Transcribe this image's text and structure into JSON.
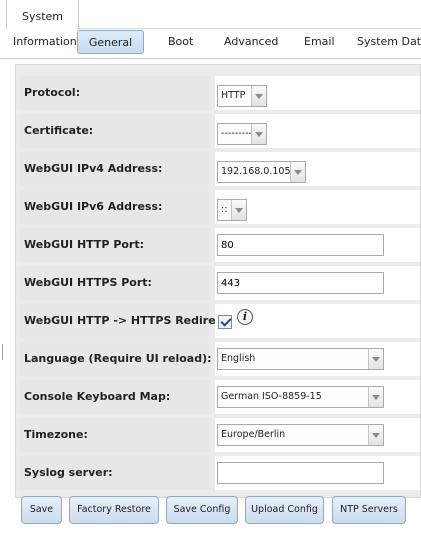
{
  "top_tab": "System",
  "subtabs": [
    "Information",
    "General",
    "Boot",
    "Advanced",
    "Email",
    "System Datas"
  ],
  "fields": {
    "protocol": {
      "label": "Protocol:",
      "value": "HTTP"
    },
    "certificate": {
      "label": "Certificate:",
      "value": "---------"
    },
    "ipv4": {
      "label": "WebGUI IPv4 Address:",
      "value": "192.168.0.105"
    },
    "ipv6": {
      "label": "WebGUI IPv6 Address:",
      "value": "::"
    },
    "http_port": {
      "label": "WebGUI HTTP Port:",
      "value": "80"
    },
    "https_port": {
      "label": "WebGUI HTTPS Port:",
      "value": "443"
    },
    "redirect": {
      "label": "WebGUI HTTP -> HTTPS Redirect:",
      "checked": true
    },
    "language": {
      "label": "Language (Require UI reload):",
      "value": "English"
    },
    "keyboard": {
      "label": "Console Keyboard Map:",
      "value": "German ISO-8859-15"
    },
    "timezone": {
      "label": "Timezone:",
      "value": "Europe/Berlin"
    },
    "syslog": {
      "label": "Syslog server:",
      "value": ""
    }
  },
  "buttons": {
    "save": "Save",
    "factory_restore": "Factory Restore",
    "save_config": "Save Config",
    "upload_config": "Upload Config",
    "ntp_servers": "NTP Servers"
  },
  "info_icon_glyph": "i"
}
